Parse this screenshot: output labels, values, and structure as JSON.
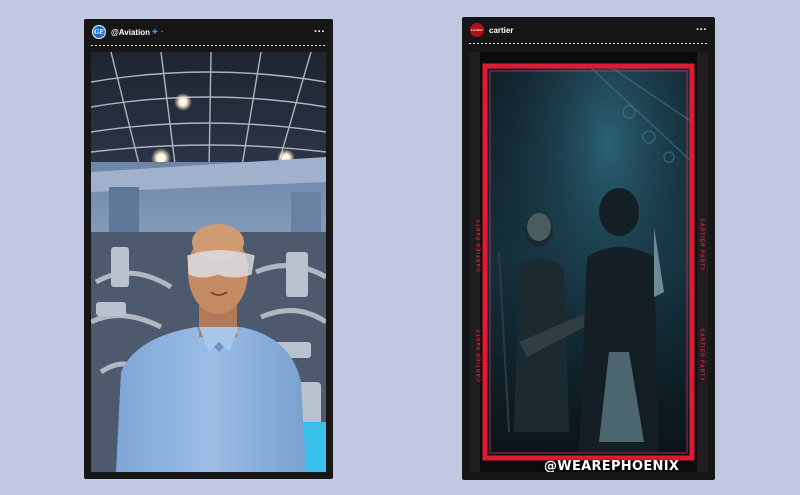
{
  "stories": [
    {
      "username": "@Aviation",
      "avatar_text": "GE",
      "verified_icon": "plane-icon",
      "meta": "·",
      "more": "···"
    },
    {
      "username": "cartier",
      "avatar_text": "Cartier",
      "more": "···",
      "mention": "@WEAREPHOENIX",
      "frame_text": "CARTIER PARTY"
    }
  ],
  "colors": {
    "background": "#c3c8e2",
    "story_bg": "#161616",
    "frame_red": "#e01a33"
  }
}
